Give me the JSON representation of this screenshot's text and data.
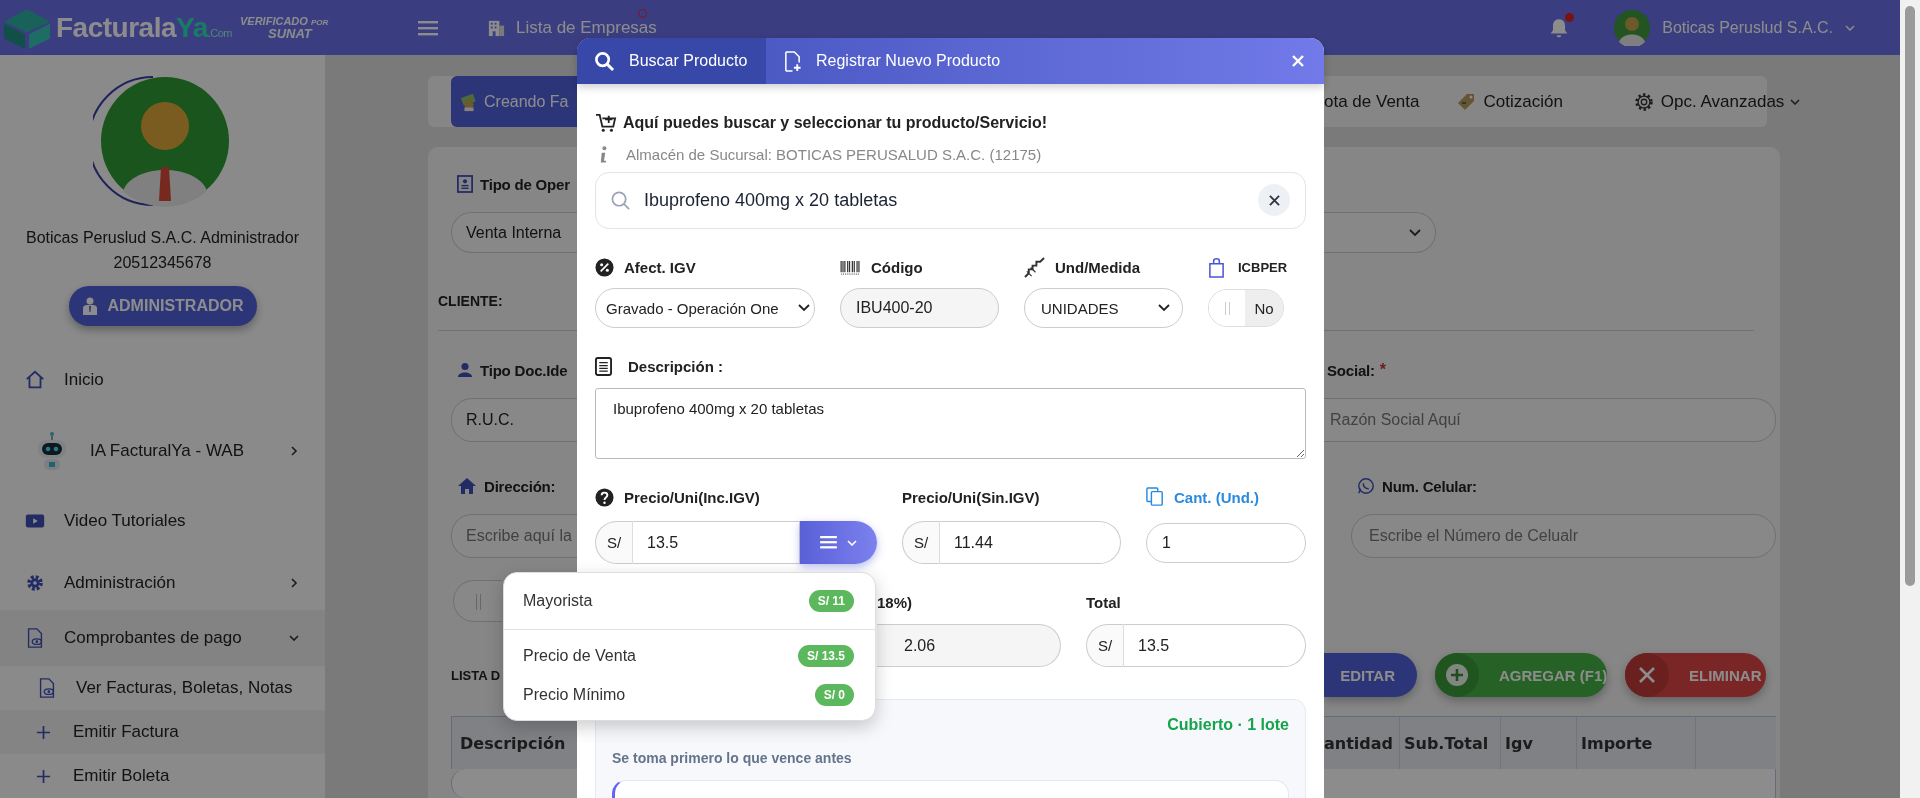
{
  "header": {
    "logo": {
      "name": "Facturala",
      "highlight": "Ya",
      "suffix": ".Com"
    },
    "verified": {
      "line1": "VERIFICADO",
      "line1_small": "POR",
      "line2": "SUNAT"
    },
    "companies_link": "Lista de Empresas",
    "companies_alert": true,
    "notifications_unread": true,
    "user_name": "Boticas Peruslud S.A.C."
  },
  "sidebar": {
    "profile_name": "Boticas Peruslud S.A.C. Administrador",
    "profile_id": "20512345678",
    "role_button": "ADMINISTRADOR",
    "menu": [
      {
        "label": "Inicio"
      },
      {
        "label": "IA FacturalYa - WAB",
        "expanded": false
      },
      {
        "label": "Video Tutoriales"
      },
      {
        "label": "Administración",
        "expanded": false
      },
      {
        "label": "Comprobantes de pago",
        "expanded": true,
        "children": [
          {
            "label": "Ver Facturas, Boletas, Notas"
          },
          {
            "label": "Emitir Factura"
          },
          {
            "label": "Emitir Boleta"
          }
        ]
      }
    ]
  },
  "toolbar": {
    "items": [
      {
        "label": "Creando Fa",
        "selected": true
      },
      {
        "label": "ota de Venta",
        "selected": false
      },
      {
        "label": "Cotización",
        "selected": false
      },
      {
        "label": "Opc. Avanzadas",
        "selected": false
      }
    ]
  },
  "form": {
    "operation_label": "Tipo de Oper",
    "operation_value": "Venta Interna",
    "client_heading": "CLIENTE:",
    "doc_type_label": "Tipo Doc.Ide",
    "doc_type_value": "R.U.C.",
    "business_name_label": "Social:",
    "business_name_required_mark": "*",
    "business_name_placeholder": "Razón Social Aquí",
    "address_label": "Dirección:",
    "address_placeholder": "Escribe aquí la",
    "phone_label": "Num. Celular:",
    "phone_placeholder": "Escribe el Número de Celualr",
    "switch_on": false,
    "list_heading": "LISTA D",
    "actions": [
      "EDITAR",
      "AGREGAR (F1)",
      "ELIMINAR"
    ],
    "table": {
      "columns": [
        "Descripción",
        "antidad",
        "Sub.Total",
        "Igv",
        "Importe"
      ]
    }
  },
  "modal": {
    "tabs": [
      {
        "label": "Buscar Producto",
        "selected": true
      },
      {
        "label": "Registrar Nuevo Producto",
        "selected": false
      }
    ],
    "intro": "Aquí puedes buscar y seleccionar tu producto/Servicio!",
    "warehouse": "Almacén de Sucursal: BOTICAS PERUSALUD S.A.C. (12175)",
    "search": {
      "value": "Ibuprofeno 400mg x 20 tabletas"
    },
    "igv_type": {
      "label": "Afect. IGV",
      "value": "Gravado - Operación One"
    },
    "code": {
      "label": "Código",
      "value": "IBU400-20"
    },
    "unit": {
      "label": "Und/Medida",
      "value": "UNIDADES"
    },
    "icbper": {
      "label": "ICBPER",
      "on": false,
      "text": "No"
    },
    "description": {
      "label": "Descripción :",
      "value": "Ibuprofeno 400mg x 20 tabletas"
    },
    "price_inc": {
      "label": "Precio/Uni(Inc.IGV)",
      "prefix": "S/",
      "value": "13.5",
      "list_open": true
    },
    "price_sin": {
      "label": "Precio/Uni(Sin.IGV)",
      "prefix": "S/",
      "value": "11.44"
    },
    "quantity": {
      "label": "Cant. (Und.)",
      "value": "1"
    },
    "igv_amount": {
      "label": "18%)",
      "value": "2.06"
    },
    "total": {
      "label": "Total",
      "prefix": "S/",
      "value": "13.5"
    },
    "stock": {
      "status": "Cubierto · 1 lote",
      "note": "Se toma primero lo que vence antes"
    },
    "price_options": [
      {
        "label": "Mayorista",
        "price": "S/ 11"
      },
      {
        "label": "Precio de Venta",
        "price": "S/ 13.5"
      },
      {
        "label": "Precio Mínimo",
        "price": "S/ 0"
      }
    ]
  }
}
